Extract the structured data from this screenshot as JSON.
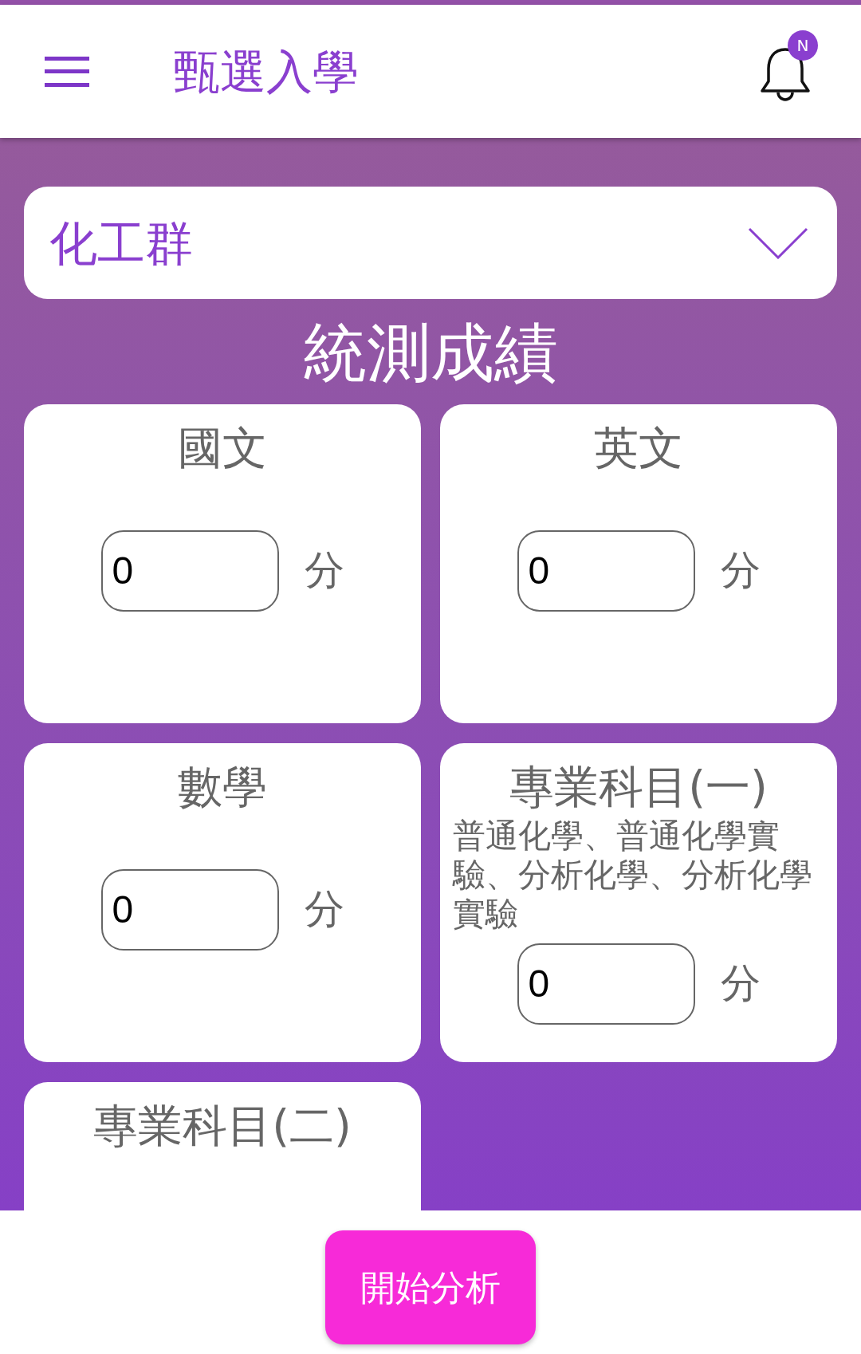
{
  "app_bar": {
    "title": "甄選入學",
    "notification_badge": "N"
  },
  "group_select": {
    "value": "化工群"
  },
  "section_title": "統測成績",
  "subjects": [
    {
      "name": "國文",
      "score": "0",
      "unit": "分"
    },
    {
      "name": "英文",
      "score": "0",
      "unit": "分"
    },
    {
      "name": "數學",
      "score": "0",
      "unit": "分"
    },
    {
      "name": "專業科目(一)",
      "note": "普通化學、普通化學實驗、分析化學、分析化學實驗",
      "score": "0",
      "unit": "分"
    },
    {
      "name": "專業科目(二)"
    }
  ],
  "action_button": "開始分析"
}
